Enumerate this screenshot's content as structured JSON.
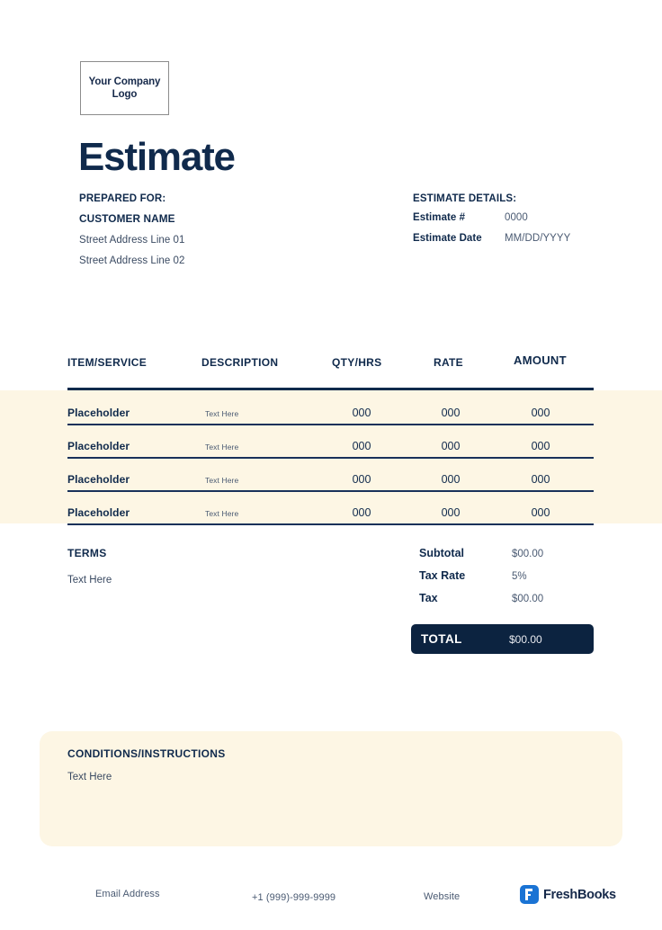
{
  "logo": {
    "line1": "Your Company",
    "line2": "Logo"
  },
  "title": "Estimate",
  "prepared_for": {
    "label": "PREPARED FOR:",
    "customer_name": "CUSTOMER NAME",
    "address_line_1": "Street Address Line 01",
    "address_line_2": "Street Address Line 02"
  },
  "estimate_details": {
    "label": "ESTIMATE DETAILS:",
    "rows": [
      {
        "key": "Estimate #",
        "value": "0000"
      },
      {
        "key": "Estimate Date",
        "value": "MM/DD/YYYY"
      }
    ]
  },
  "table": {
    "headers": {
      "item": "ITEM/SERVICE",
      "description": "DESCRIPTION",
      "qty": "QTY/HRS",
      "rate": "RATE",
      "amount": "AMOUNT"
    },
    "rows": [
      {
        "item": "Placeholder",
        "description": "Text Here",
        "qty": "000",
        "rate": "000",
        "amount": "000"
      },
      {
        "item": "Placeholder",
        "description": "Text Here",
        "qty": "000",
        "rate": "000",
        "amount": "000"
      },
      {
        "item": "Placeholder",
        "description": "Text Here",
        "qty": "000",
        "rate": "000",
        "amount": "000"
      },
      {
        "item": "Placeholder",
        "description": "Text Here",
        "qty": "000",
        "rate": "000",
        "amount": "000"
      }
    ]
  },
  "terms": {
    "title": "TERMS",
    "body": "Text Here"
  },
  "totals": {
    "rows": [
      {
        "key": "Subtotal",
        "value": "$00.00"
      },
      {
        "key": "Tax Rate",
        "value": "5%"
      },
      {
        "key": "Tax",
        "value": "$00.00"
      }
    ],
    "total_label": "TOTAL",
    "total_value": "$00.00"
  },
  "conditions": {
    "title": "CONDITIONS/INSTRUCTIONS",
    "body": "Text Here"
  },
  "footer": {
    "email": "Email Address",
    "phone": "+1 (999)-999-9999",
    "website": "Website",
    "brand_name": "FreshBooks"
  },
  "colors": {
    "navy": "#0C2340",
    "cream": "#FDF6E4",
    "brand_blue": "#1A73D4",
    "body_text": "#3A4A62"
  }
}
